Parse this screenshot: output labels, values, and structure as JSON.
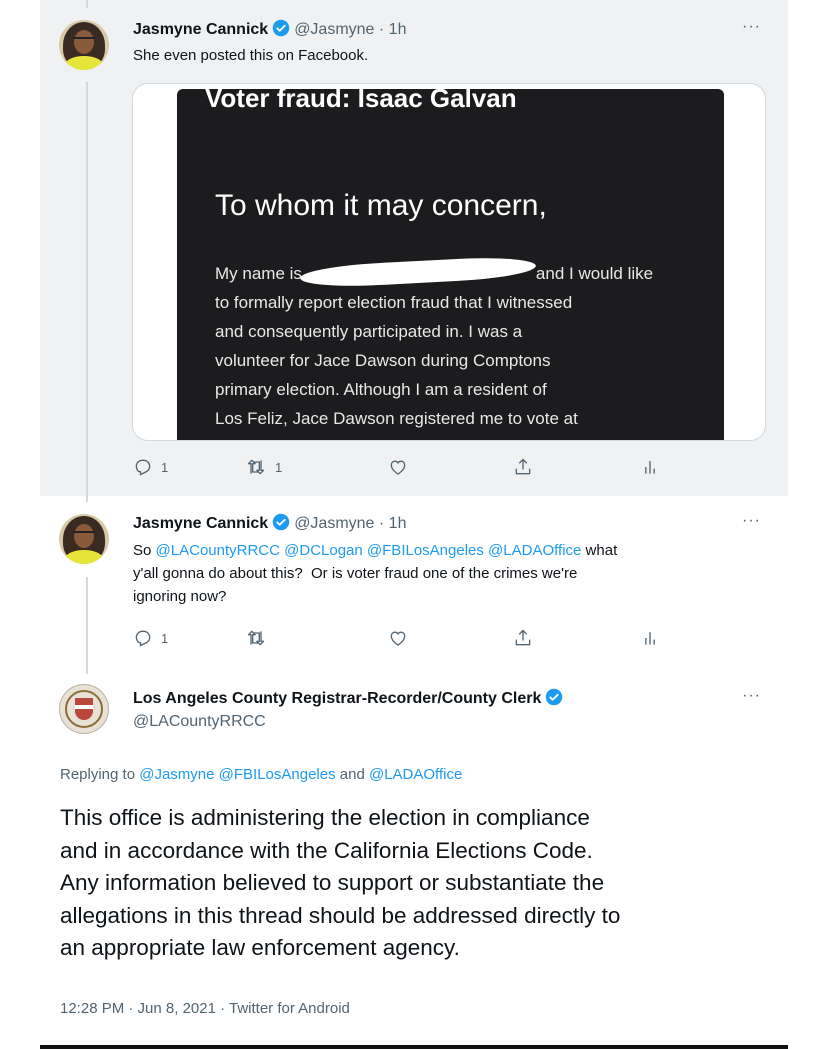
{
  "tweet1": {
    "name": "Jasmyne Cannick",
    "handle_time": "@Jasmyne · 1h",
    "text": "She even posted this on Facebook.",
    "card": {
      "title": "Voter fraud: Isaac Galvan",
      "heading": "To whom it may concern,",
      "lines": [
        "My name is",
        "and I would like",
        "to formally report election fraud that I witnessed",
        "and consequently participated in. I was a",
        "volunteer for Jace Dawson during Comptons",
        "primary election. Although I am a resident of",
        "Los Feliz, Jace Dawson registered me to vote at"
      ]
    },
    "reply_count": "1",
    "retweet_count": "1"
  },
  "tweet2": {
    "name": "Jasmyne Cannick",
    "handle_time": "@Jasmyne · 1h",
    "line1_prefix": "So",
    "mentions": [
      "@LACountyRRCC",
      "@DCLogan",
      "@FBILosAngeles",
      "@LADAOffice"
    ],
    "line1_suffix": "what",
    "line2": "y'all gonna do about this?  Or is voter fraud one of the crimes we're",
    "line3": "ignoring now?",
    "reply_count": "1"
  },
  "tweet3": {
    "name": "Los Angeles County Registrar-Recorder/County Clerk",
    "handle": "@LACountyRRCC",
    "replying_prefix": "Replying to",
    "replying_to": [
      "@Jasmyne",
      "@FBILosAngeles",
      "@LADAOffice"
    ],
    "replying_and": "and",
    "text_lines": [
      "This office is administering the election in compliance",
      "and in accordance with the California Elections Code.",
      "Any information believed to support or substantiate the",
      "allegations in this thread should be addressed directly to",
      "an appropriate law enforcement agency."
    ],
    "timestamp": "12:28 PM · Jun 8, 2021 · Twitter for Android"
  },
  "colors": {
    "accent": "#1d9bf0",
    "secondary_text": "#536471",
    "panel_bg": "#f0f1f2"
  },
  "icons": [
    "verified-icon",
    "more-icon",
    "reply-icon",
    "retweet-icon",
    "like-icon",
    "share-icon",
    "analytics-icon"
  ]
}
